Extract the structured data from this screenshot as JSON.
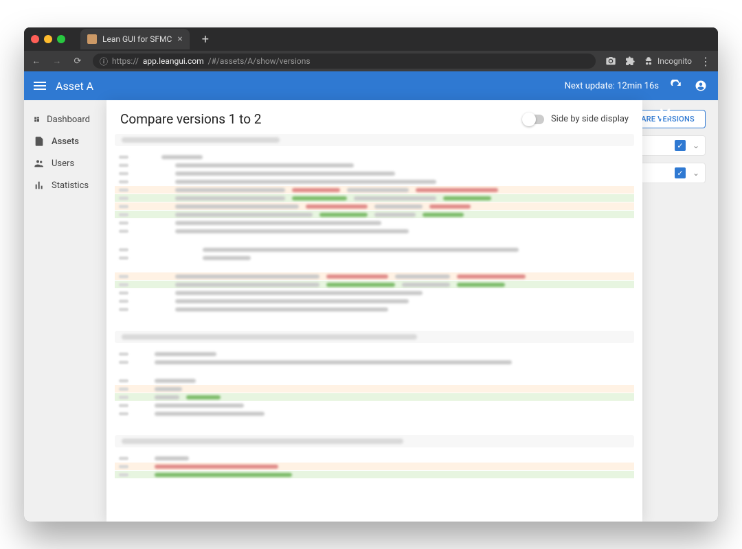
{
  "browser": {
    "tab_title": "Lean GUI for SFMC",
    "url_host": "app.leangui.com",
    "url_path": "/#/assets/A/show/versions",
    "incognito_label": "Incognito"
  },
  "appbar": {
    "title": "Asset A",
    "next_update": "Next update: 12min 16s"
  },
  "sidebar": {
    "items": [
      "Dashboard",
      "Assets",
      "Users",
      "Statistics"
    ],
    "active_index": 1
  },
  "compare_button": "ARE VERSIONS",
  "modal": {
    "title": "Compare versions 1 to 2",
    "toggle_label": "Side by side display"
  }
}
